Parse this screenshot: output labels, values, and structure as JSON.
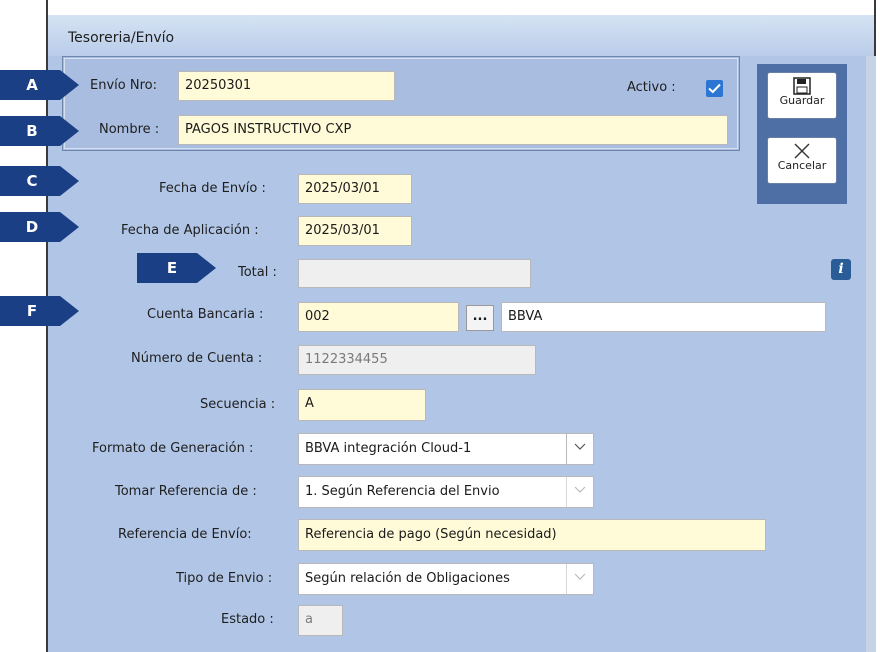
{
  "window": {
    "title": "Tesoreria/Envío"
  },
  "callouts": [
    "A",
    "B",
    "C",
    "D",
    "E",
    "F"
  ],
  "form": {
    "envio_nro": {
      "label": "Envío Nro:",
      "value": "20250301"
    },
    "activo": {
      "label": "Activo :",
      "checked": true
    },
    "nombre": {
      "label": "Nombre :",
      "value": "PAGOS INSTRUCTIVO CXP"
    },
    "fecha_envio": {
      "label": "Fecha de Envío :",
      "value": "2025/03/01"
    },
    "fecha_aplicacion": {
      "label": "Fecha de Aplicación :",
      "value": "2025/03/01"
    },
    "total": {
      "label": "Total :",
      "value": ""
    },
    "cuenta_bancaria": {
      "label": "Cuenta Bancaria :",
      "code": "002",
      "lookup_label": "...",
      "bank_name": "BBVA"
    },
    "numero_cuenta": {
      "label": "Número de Cuenta :",
      "value": "1122334455"
    },
    "secuencia": {
      "label": "Secuencia :",
      "value": "A"
    },
    "formato_generacion": {
      "label": "Formato de Generación :",
      "value": "BBVA integración Cloud-1"
    },
    "tomar_referencia": {
      "label": "Tomar Referencia de :",
      "value": "1. Según Referencia del Envio"
    },
    "referencia_envio": {
      "label": "Referencia de Envío:",
      "value": "Referencia de pago (Según necesidad)"
    },
    "tipo_envio": {
      "label": "Tipo de Envio :",
      "value": "Según relación de Obligaciones"
    },
    "estado": {
      "label": "Estado :",
      "value": "a"
    }
  },
  "toolbar": {
    "save_label": "Guardar",
    "cancel_label": "Cancelar"
  },
  "info": {
    "glyph": "i"
  },
  "colors": {
    "window_bg": "#b1c6e6",
    "field_bg": "#fffbd9",
    "callout_bg": "#1b3f85",
    "toolbar_bg": "#4e6fa6",
    "checkbox": "#2c75d3"
  }
}
